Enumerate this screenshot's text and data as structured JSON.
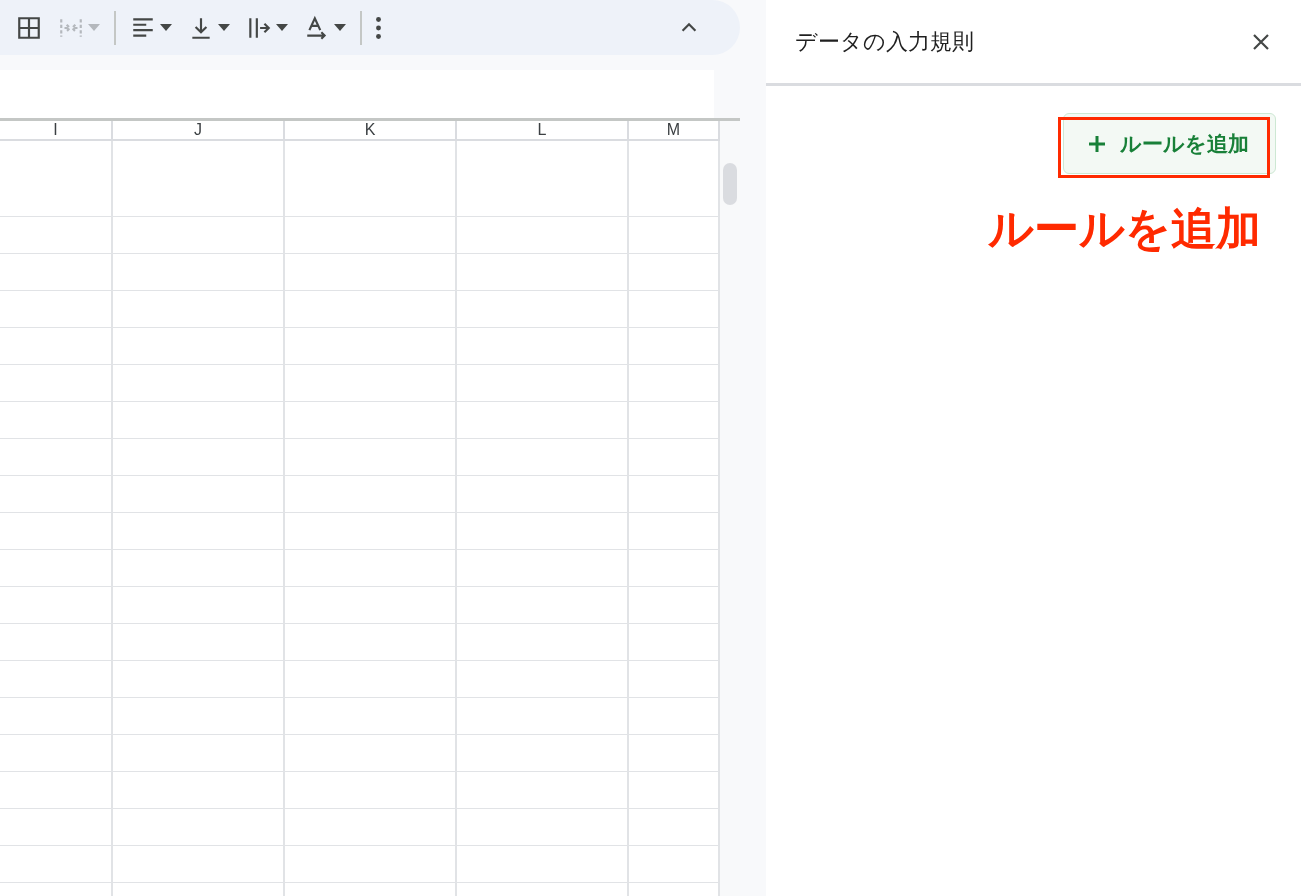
{
  "toolbar": {
    "items": [
      {
        "kind": "button",
        "disabled": false,
        "dropdown": false
      },
      {
        "kind": "button",
        "disabled": true,
        "dropdown": true
      },
      {
        "kind": "divider"
      },
      {
        "kind": "button",
        "disabled": false,
        "dropdown": true
      },
      {
        "kind": "button",
        "disabled": false,
        "dropdown": true
      },
      {
        "kind": "button",
        "disabled": false,
        "dropdown": true
      },
      {
        "kind": "button",
        "disabled": false,
        "dropdown": true
      },
      {
        "kind": "divider"
      },
      {
        "kind": "button",
        "disabled": false,
        "dropdown": false
      }
    ],
    "collapsed": false
  },
  "sheet": {
    "columns": [
      "I",
      "J",
      "K",
      "L",
      "M"
    ]
  },
  "panel": {
    "title": "データの入力規則",
    "add_rule_button": {
      "label": "ルールを追加"
    }
  },
  "annotation": {
    "text": "ルールを追加"
  }
}
